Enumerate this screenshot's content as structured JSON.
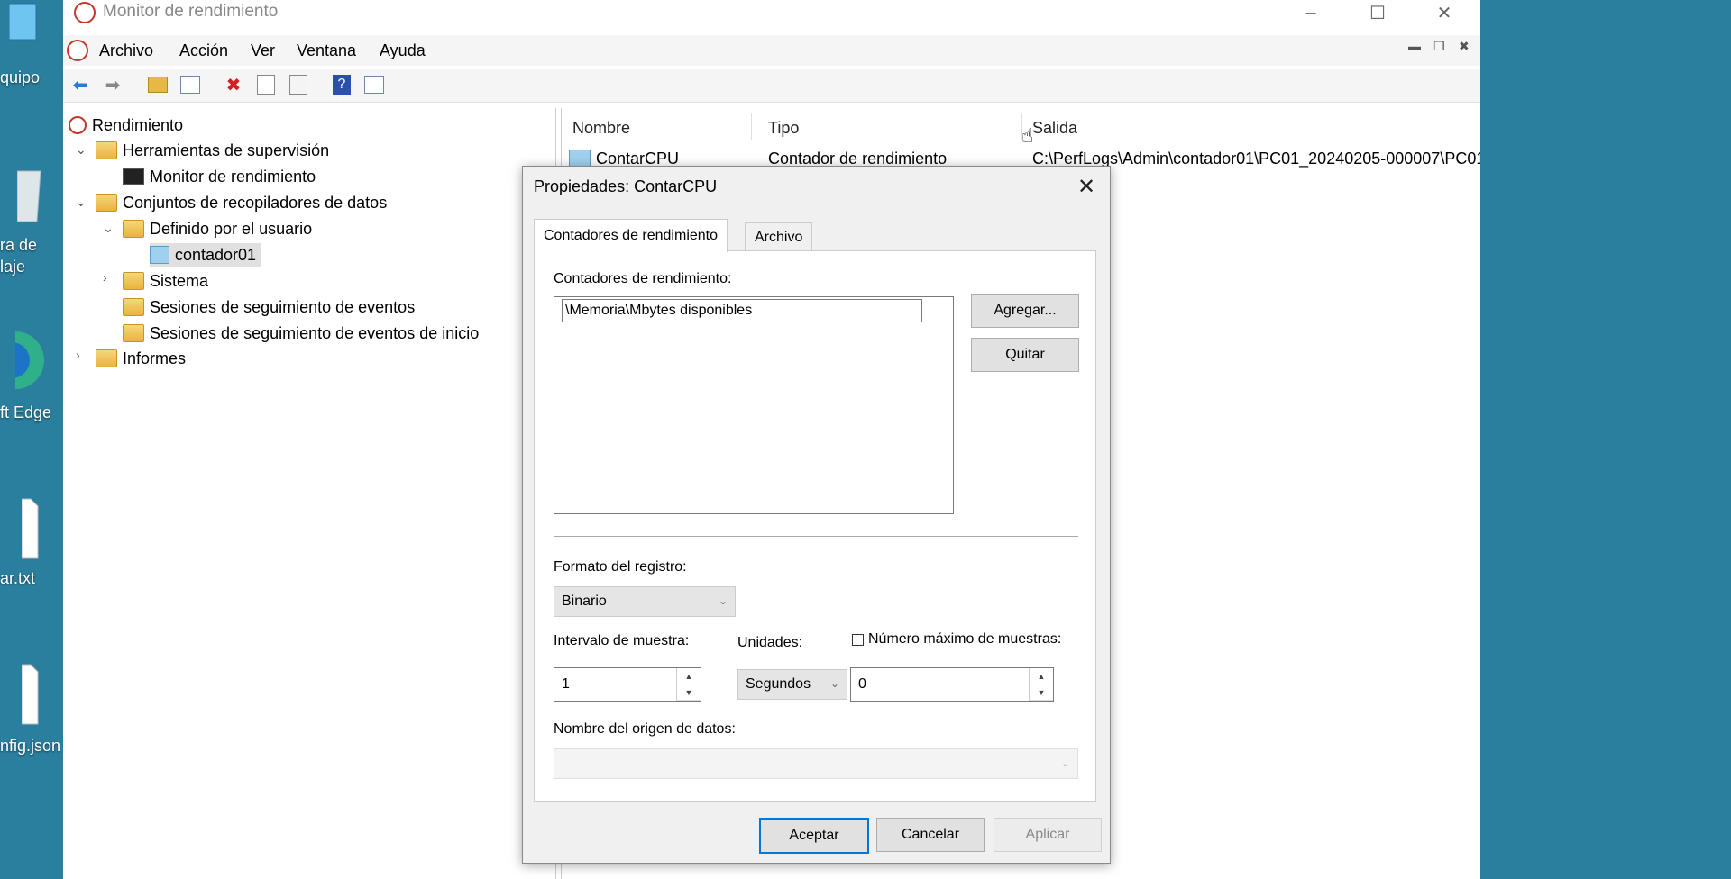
{
  "desktop": {
    "icons": [
      {
        "label": "quipo"
      },
      {
        "label": "ra de"
      },
      {
        "label": "laje"
      },
      {
        "label": "ft Edge"
      },
      {
        "label": "ar.txt"
      },
      {
        "label": "nfig.json"
      }
    ]
  },
  "window": {
    "title": "Monitor de rendimiento"
  },
  "menu": [
    "Archivo",
    "Acción",
    "Ver",
    "Ventana",
    "Ayuda"
  ],
  "tree": {
    "root": "Rendimiento",
    "herramientas": "Herramientas de supervisión",
    "monitor": "Monitor de rendimiento",
    "conjuntos": "Conjuntos de recopiladores de datos",
    "definido": "Definido por el usuario",
    "contador": "contador01",
    "sistema": "Sistema",
    "sesiones": "Sesiones de seguimiento de eventos",
    "sesiones_inicio": "Sesiones de seguimiento de eventos de inicio",
    "informes": "Informes"
  },
  "list": {
    "columns": [
      "Nombre",
      "Tipo",
      "Salida"
    ],
    "rows": [
      {
        "nombre": "ContarCPU",
        "tipo": "Contador de rendimiento",
        "salida": "C:\\PerfLogs\\Admin\\contador01\\PC01_20240205-000007\\PC01"
      }
    ]
  },
  "dialog": {
    "title": "Propiedades: ContarCPU",
    "tabs": [
      "Contadores de rendimiento",
      "Archivo"
    ],
    "counters_label": "Contadores de rendimiento:",
    "counters": [
      "\\Memoria\\Mbytes disponibles"
    ],
    "add_button": "Agregar...",
    "remove_button": "Quitar",
    "format_label": "Formato del registro:",
    "format_value": "Binario",
    "interval_label": "Intervalo de muestra:",
    "interval_value": "1",
    "units_label": "Unidades:",
    "units_value": "Segundos",
    "max_samples_label": "Número máximo de muestras:",
    "max_samples_value": "0",
    "datasource_label": "Nombre del origen de datos:",
    "ok": "Aceptar",
    "cancel": "Cancelar",
    "apply": "Aplicar"
  }
}
